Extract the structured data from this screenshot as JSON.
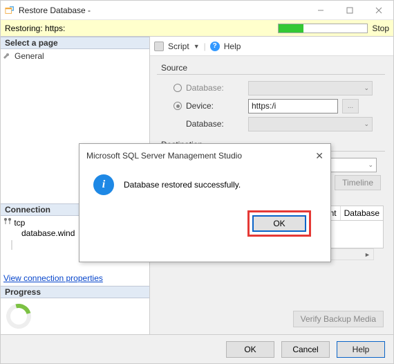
{
  "title": "Restore Database -",
  "statusbar": {
    "label": "Restoring: https:",
    "stop": "Stop",
    "progress_percent": 28
  },
  "left": {
    "select_page": "Select a page",
    "general": "General",
    "connection_hd": "Connection",
    "conn_line1": "tcp",
    "conn_line2": "database.wind",
    "view_props": "View connection properties",
    "progress_hd": "Progress"
  },
  "toolbar": {
    "script": "Script",
    "help": "Help"
  },
  "panel": {
    "source_label": "Source",
    "database_radio": "Database:",
    "device_radio": "Device:",
    "device_value": "https:/i",
    "database_field": "Database:",
    "destination_label": "Destination",
    "timeline_btn": "Timeline",
    "grid": {
      "component": "Component",
      "database": "Database"
    },
    "verify_btn": "Verify Backup Media"
  },
  "bottom": {
    "ok": "OK",
    "cancel": "Cancel",
    "help": "Help"
  },
  "modal": {
    "title": "Microsoft SQL Server Management Studio",
    "message": "Database restored successfully.",
    "ok": "OK"
  }
}
